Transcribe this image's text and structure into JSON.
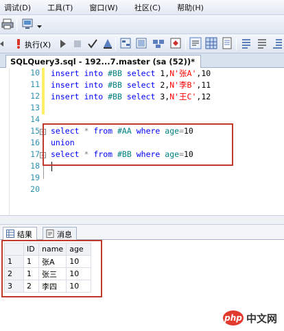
{
  "menu": [
    "调试(D)",
    "工具(T)",
    "窗口(W)",
    "社区(C)",
    "帮助(H)"
  ],
  "toolbar": {
    "execute_label": "执行(X)"
  },
  "tab": {
    "title": "SQLQuery3.sql - 192...7.master (sa (52))*"
  },
  "editor": {
    "lines": [
      {
        "num": "10",
        "kw1": "insert",
        "kw2": "into",
        "tbl": "#BB",
        "kw3": "select",
        "rest": "1,",
        "str": "N'张A'",
        "tail": ",10"
      },
      {
        "num": "11",
        "kw1": "insert",
        "kw2": "into",
        "tbl": "#BB",
        "kw3": "select",
        "rest": "2,",
        "str": "N'李B'",
        "tail": ",11"
      },
      {
        "num": "12",
        "kw1": "insert",
        "kw2": "into",
        "tbl": "#BB",
        "kw3": "select",
        "rest": "3,",
        "str": "N'王C'",
        "tail": ",12"
      }
    ],
    "empty_nums": [
      "13",
      "14",
      "19",
      "20"
    ],
    "query": [
      {
        "num": "15",
        "text1": "select",
        "op": "*",
        "text2": "from",
        "tbl": "#AA",
        "text3": "where",
        "col": "age",
        "eq": "=",
        "val": "10"
      },
      {
        "num": "16",
        "text1": "union"
      },
      {
        "num": "17",
        "text1": "select",
        "op": "*",
        "text2": "from",
        "tbl": "#BB",
        "text3": "where",
        "col": "age",
        "eq": "=",
        "val": "10"
      },
      {
        "num": "18"
      }
    ]
  },
  "results": {
    "tabs": [
      "结果",
      "消息"
    ],
    "columns": [
      "ID",
      "name",
      "age"
    ],
    "rows": [
      {
        "n": "1",
        "id": "1",
        "name": "张A",
        "age": "10"
      },
      {
        "n": "2",
        "id": "1",
        "name": "张三",
        "age": "10"
      },
      {
        "n": "3",
        "id": "2",
        "name": "李四",
        "age": "10"
      }
    ]
  },
  "watermark": {
    "logo": "php",
    "text": "中文网"
  },
  "colors": {
    "keyword": "#0000ff",
    "string": "#ff0000",
    "highlight_box": "#c0392b"
  }
}
